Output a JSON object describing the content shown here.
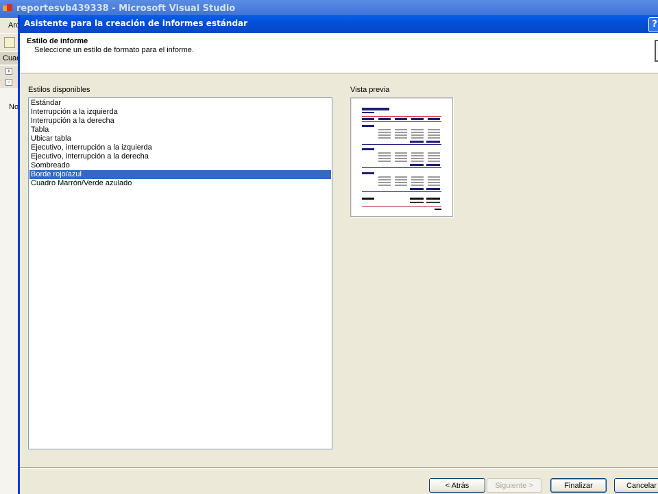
{
  "background_window": {
    "title": "reportesvb439338 - Microsoft Visual Studio",
    "menu_fragment": "Arc",
    "panel_tab_fragment": "Cuad",
    "panel_text_fragment": "No"
  },
  "dialog": {
    "title": "Asistente para la creación de informes estándar",
    "help_label": "?",
    "header": {
      "title": "Estilo de informe",
      "subtitle": "Seleccione un estilo de formato para el informe."
    },
    "styles_label": "Estilos disponibles",
    "styles": [
      "Estándar",
      "Interrupción a la izquierda",
      "Interrupción a la derecha",
      "Tabla",
      "Ubicar tabla",
      "Ejecutivo, interrupción a la izquierda",
      "Ejecutivo, interrupción a la derecha",
      "Sombreado",
      "Borde rojo/azul",
      "Cuadro Marrón/Verde azulado"
    ],
    "selected_style": "Borde rojo/azul",
    "preview_label": "Vista previa",
    "buttons": {
      "back": "< Atrás",
      "next": "Siguiente >",
      "finish": "Finalizar",
      "cancel": "Cancelar"
    }
  },
  "colors": {
    "title_bar": "#0450d8",
    "selection": "#316ac5",
    "preview_navy": "#1b1f7a",
    "preview_red": "#c81e1e",
    "preview_gray": "#9a9a9a"
  }
}
